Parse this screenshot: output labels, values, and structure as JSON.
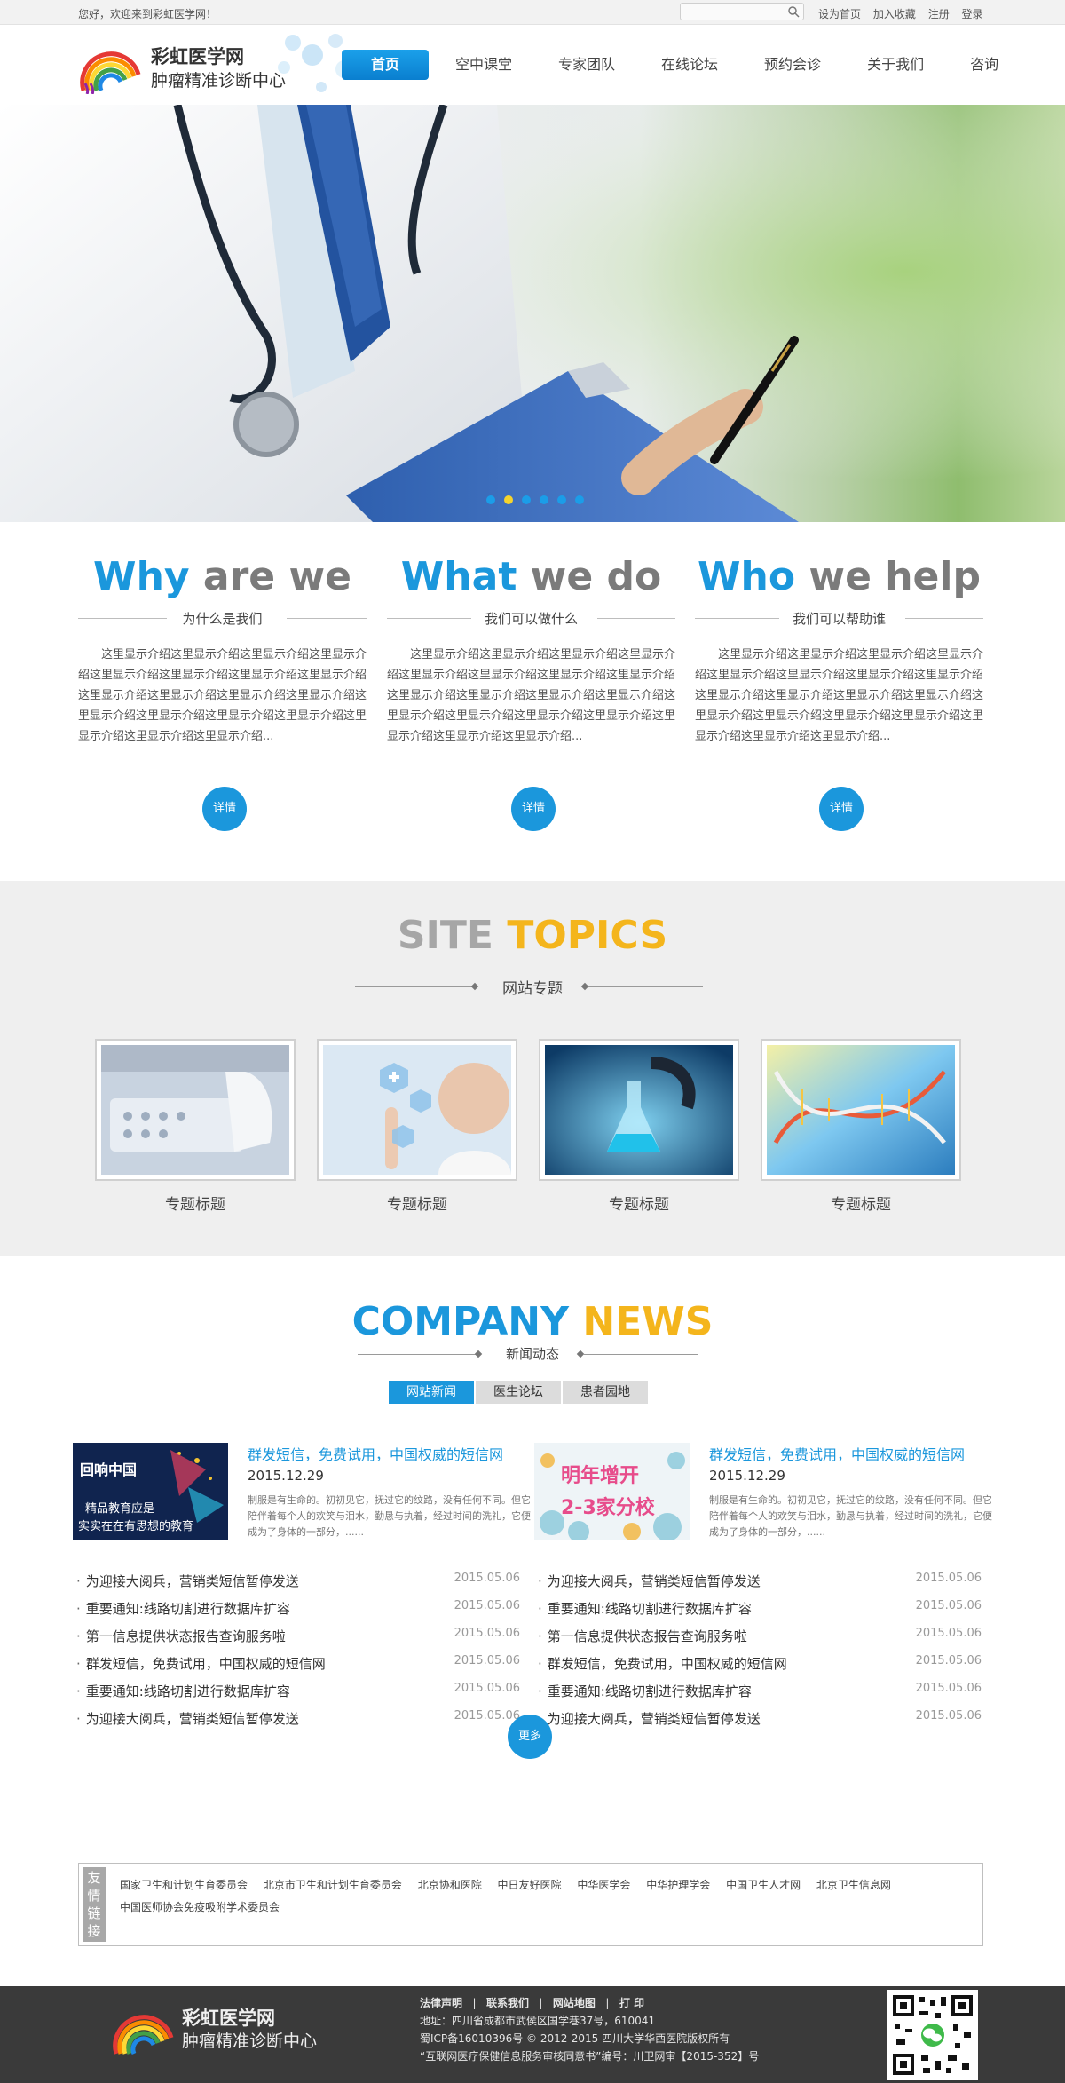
{
  "topbar": {
    "welcome": "您好，欢迎来到彩虹医学网！",
    "search_placeholder": "",
    "links": [
      "设为首页",
      "加入收藏",
      "注册",
      "登录"
    ]
  },
  "header": {
    "brand_line1": "彩虹医学网",
    "brand_line2": "肿瘤精准诊断中心",
    "nav": [
      "首页",
      "空中课堂",
      "专家团队",
      "在线论坛",
      "预约会诊",
      "关于我们",
      "咨询"
    ],
    "active_nav": "首页"
  },
  "banner": {
    "dots": 6,
    "active_dot": 2
  },
  "about": {
    "columns": [
      {
        "title_blue": "Why",
        "title_gray": " are we",
        "subtitle": "为什么是我们",
        "desc": "这里显示介绍这里显示介绍这里显示介绍这里显示介绍这里显示介绍这里显示介绍这里显示介绍这里显示介绍这里显示介绍这里显示介绍这里显示介绍这里显示介绍这里显示介绍这里显示介绍这里显示介绍这里显示介绍这里显示介绍这里显示介绍这里显示介绍...",
        "button": "详情"
      },
      {
        "title_blue": "What",
        "title_gray": " we do",
        "subtitle": "我们可以做什么",
        "desc": "这里显示介绍这里显示介绍这里显示介绍这里显示介绍这里显示介绍这里显示介绍这里显示介绍这里显示介绍这里显示介绍这里显示介绍这里显示介绍这里显示介绍这里显示介绍这里显示介绍这里显示介绍这里显示介绍这里显示介绍这里显示介绍这里显示介绍...",
        "button": "详情"
      },
      {
        "title_blue": "Who",
        "title_gray": " we help",
        "subtitle": "我们可以帮助谁",
        "desc": "这里显示介绍这里显示介绍这里显示介绍这里显示介绍这里显示介绍这里显示介绍这里显示介绍这里显示介绍这里显示介绍这里显示介绍这里显示介绍这里显示介绍这里显示介绍这里显示介绍这里显示介绍这里显示介绍这里显示介绍这里显示介绍这里显示介绍...",
        "button": "详情"
      }
    ]
  },
  "topics": {
    "title_gray": "SITE",
    "title_yellow": "TOPICS",
    "subtitle": "网站专题",
    "items": [
      "专题标题",
      "专题标题",
      "专题标题",
      "专题标题"
    ]
  },
  "news": {
    "title_blue": "COMPANY",
    "title_yellow": "NEWS",
    "subtitle": "新闻动态",
    "tabs": [
      "网站新闻",
      "医生论坛",
      "患者园地"
    ],
    "active_tab": "网站新闻",
    "blocks": [
      {
        "image_caption": [
          "精品教育应是",
          "实实在在有思想的教育"
        ],
        "image_badge": "回响中国",
        "feat_title": "群发短信，免费试用，中国权威的短信网",
        "feat_date": "2015.12.29",
        "feat_desc": "制服是有生命的。初初见它，抚过它的纹路，没有任何不同。但它陪伴着每个人的欢笑与泪水，勤恳与执着，经过时间的洗礼，它便成为了身体的一部分，......",
        "list": [
          {
            "title": "为迎接大阅兵，营销类短信暂停发送",
            "date": "2015.05.06"
          },
          {
            "title": "重要通知:线路切割进行数据库扩容",
            "date": "2015.05.06"
          },
          {
            "title": "第一信息提供状态报告查询服务啦",
            "date": "2015.05.06"
          },
          {
            "title": "群发短信，免费试用，中国权威的短信网",
            "date": "2015.05.06"
          },
          {
            "title": "重要通知:线路切割进行数据库扩容",
            "date": "2015.05.06"
          },
          {
            "title": "为迎接大阅兵，营销类短信暂停发送",
            "date": "2015.05.06"
          }
        ]
      },
      {
        "image_caption": [
          "明年增开",
          "2-3家分校"
        ],
        "image_badge": "",
        "feat_title": "群发短信，免费试用，中国权威的短信网",
        "feat_date": "2015.12.29",
        "feat_desc": "制服是有生命的。初初见它，抚过它的纹路，没有任何不同。但它陪伴着每个人的欢笑与泪水，勤恳与执着，经过时间的洗礼，它便成为了身体的一部分，......",
        "list": [
          {
            "title": "为迎接大阅兵，营销类短信暂停发送",
            "date": "2015.05.06"
          },
          {
            "title": "重要通知:线路切割进行数据库扩容",
            "date": "2015.05.06"
          },
          {
            "title": "第一信息提供状态报告查询服务啦",
            "date": "2015.05.06"
          },
          {
            "title": "群发短信，免费试用，中国权威的短信网",
            "date": "2015.05.06"
          },
          {
            "title": "重要通知:线路切割进行数据库扩容",
            "date": "2015.05.06"
          },
          {
            "title": "为迎接大阅兵，营销类短信暂停发送",
            "date": "2015.05.06"
          }
        ]
      }
    ],
    "more": "更多"
  },
  "friends": {
    "label": [
      "友",
      "情",
      "链",
      "接"
    ],
    "links": [
      "国家卫生和计划生育委员会",
      "北京市卫生和计划生育委员会",
      "北京协和医院",
      "中日友好医院",
      "中华医学会",
      "中华护理学会",
      "中国卫生人才网",
      "北京卫生信息网",
      "中国医师协会免疫吸附学术委员会"
    ]
  },
  "footer": {
    "brand_line1": "彩虹医学网",
    "brand_line2": "肿瘤精准诊断中心",
    "links": [
      "法律声明",
      "联系我们",
      "网站地图",
      "打 印"
    ],
    "address": "地址：四川省成都市武侯区国学巷37号，610041",
    "icp": "蜀ICP备16010396号 © 2012-2015 四川大学华西医院版权所有",
    "license": "“互联网医疗保健信息服务审核同意书”编号：川卫网审【2015-352】号"
  },
  "colors": {
    "accent_blue": "#1b97dc",
    "accent_yellow": "#f4b51c",
    "footer_bg": "#3a3a3a"
  }
}
